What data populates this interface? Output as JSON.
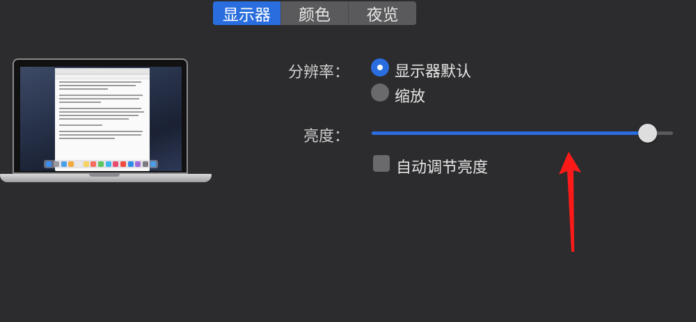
{
  "tabs": [
    {
      "label": "显示器",
      "active": true
    },
    {
      "label": "颜色",
      "active": false
    },
    {
      "label": "夜览",
      "active": false
    }
  ],
  "resolution": {
    "label": "分辨率：",
    "options": [
      {
        "label": "显示器默认",
        "selected": true
      },
      {
        "label": "缩放",
        "selected": false
      }
    ]
  },
  "brightness": {
    "label": "亮度：",
    "value": 0.915
  },
  "auto_brightness": {
    "label": "自动调节亮度",
    "checked": false
  },
  "colors": {
    "accent": "#2a6ddf",
    "annotation_arrow": "#ff1a1a"
  }
}
